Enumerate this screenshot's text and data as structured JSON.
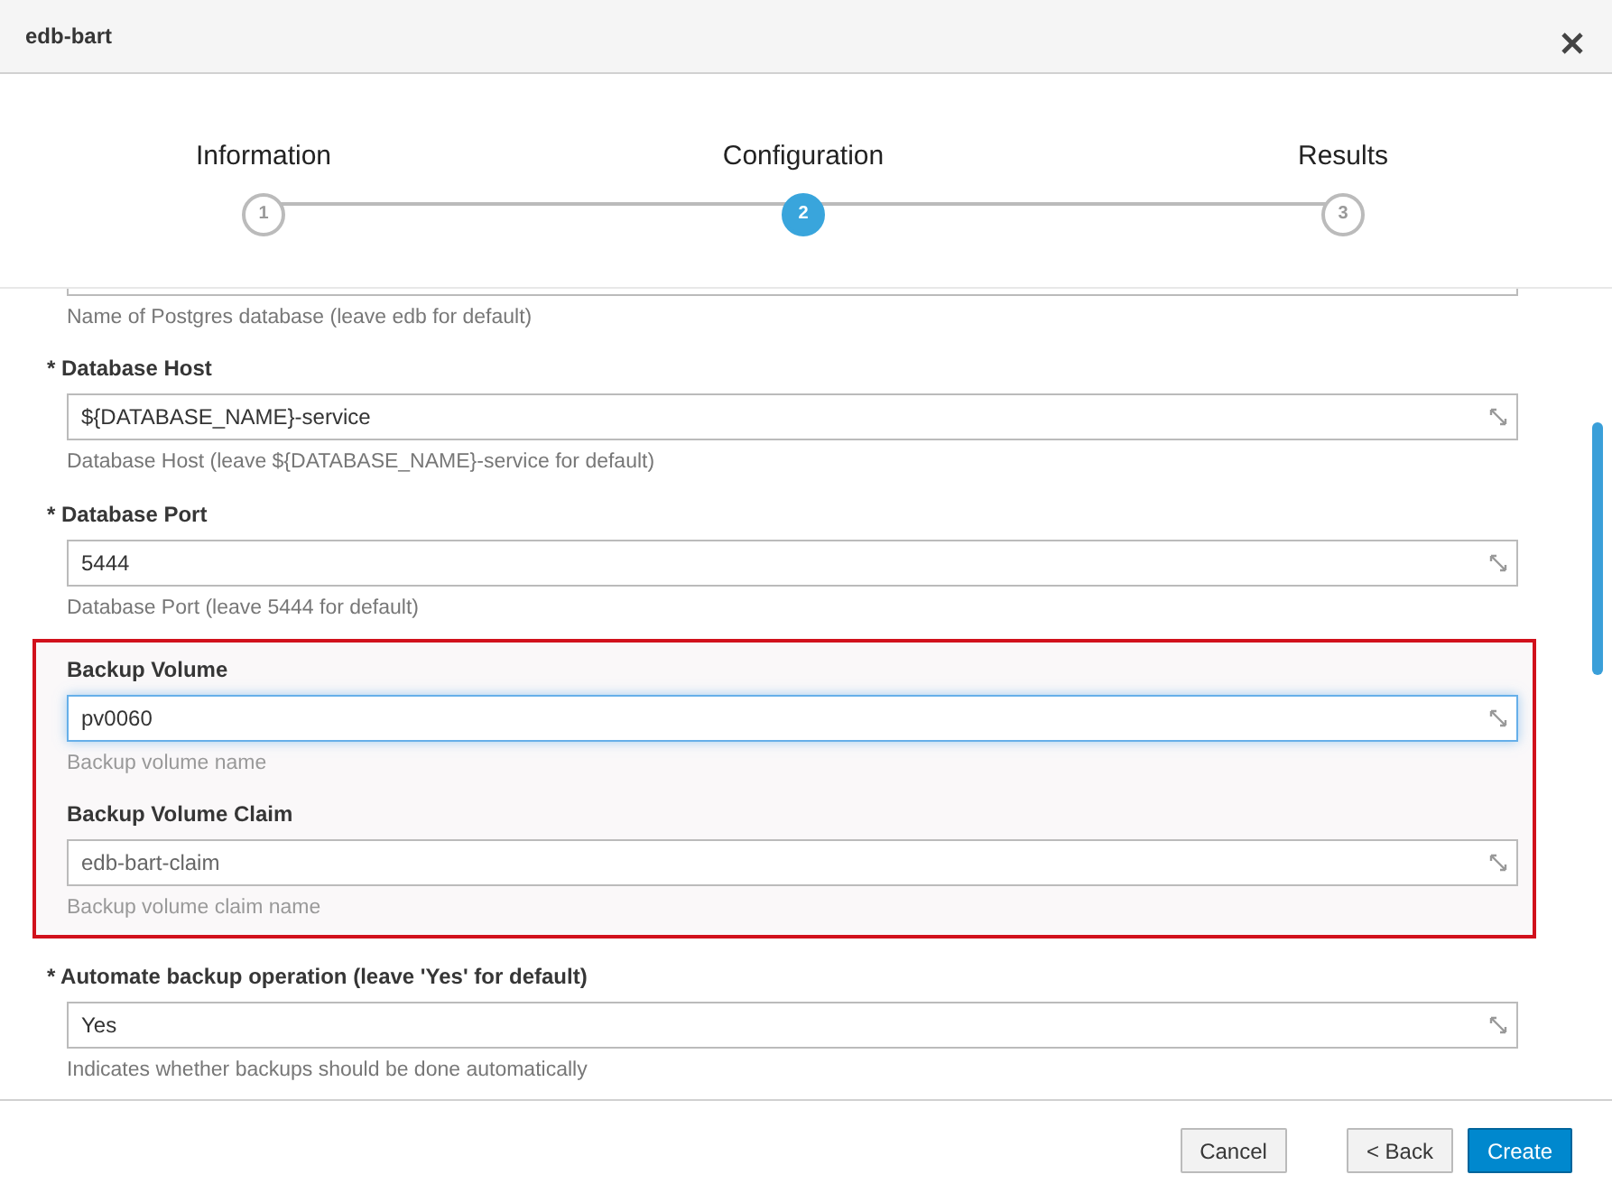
{
  "window": {
    "title": "edb-bart"
  },
  "steps": [
    {
      "number": "1",
      "label": "Information",
      "selected": false
    },
    {
      "number": "2",
      "label": "Configuration",
      "selected": true
    },
    {
      "number": "3",
      "label": "Results",
      "selected": false
    }
  ],
  "first_help": "Name of Postgres database (leave edb for default)",
  "fields": [
    {
      "label": "* Database Host",
      "value": "${DATABASE_NAME}-service",
      "help": "Database Host (leave ${DATABASE_NAME}-service for default)",
      "focused": false,
      "highlighted": false
    },
    {
      "label": "* Database Port",
      "value": "5444",
      "help": "Database Port (leave 5444 for default)",
      "focused": false,
      "highlighted": false
    },
    {
      "label": "Backup Volume",
      "value": "pv0060",
      "help": "Backup volume name",
      "focused": true,
      "highlighted": true
    },
    {
      "label": "Backup Volume Claim",
      "placeholder": "edb-bart-claim",
      "help": "Backup volume claim name",
      "focused": false,
      "highlighted": true
    },
    {
      "label": "* Automate backup operation (leave 'Yes' for default)",
      "value": "Yes",
      "help": "Indicates whether backups should be done automatically",
      "focused": false,
      "highlighted": false
    }
  ],
  "buttons": [
    {
      "label": "Cancel",
      "kind": "default"
    },
    {
      "label": "< Back",
      "kind": "default"
    },
    {
      "label": "Create",
      "kind": "primary"
    }
  ]
}
